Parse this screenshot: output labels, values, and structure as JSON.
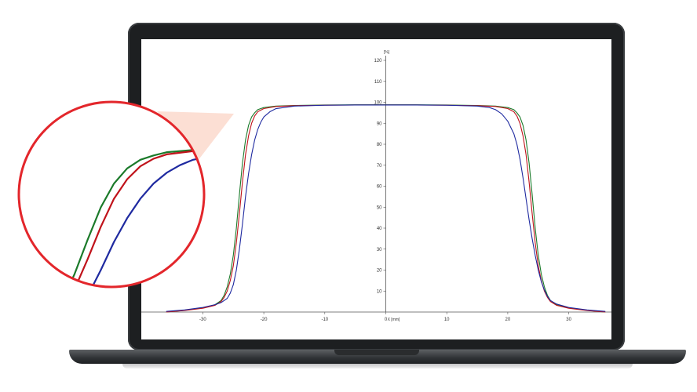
{
  "chart_data": {
    "type": "line",
    "title": "",
    "xlabel": "X [mm]",
    "ylabel": "[%]",
    "xlim": [
      -37,
      37
    ],
    "ylim": [
      0,
      120
    ],
    "x_ticks": [
      -30,
      -20,
      -10,
      0,
      10,
      20,
      30
    ],
    "y_ticks": [
      10,
      20,
      30,
      40,
      50,
      60,
      70,
      80,
      90,
      100,
      110,
      120
    ],
    "grid": false,
    "series": [
      {
        "color": "#1b7a2a",
        "x": [
          -36,
          -33,
          -30,
          -28,
          -27,
          -26.5,
          -26,
          -25.5,
          -25,
          -24.5,
          -24,
          -23.5,
          -23,
          -22.5,
          -22,
          -21.5,
          -21,
          -20,
          -18,
          -15,
          -10,
          -5,
          0,
          5,
          10,
          15,
          18,
          20,
          21,
          21.5,
          22,
          22.5,
          23,
          23.5,
          24,
          24.5,
          25,
          25.5,
          26,
          26.5,
          27,
          28,
          30,
          33,
          36
        ],
        "y": [
          0,
          0.8,
          2,
          3.5,
          5.5,
          8,
          12,
          18,
          27,
          40,
          56,
          71,
          82,
          89,
          93,
          95,
          96.5,
          97.5,
          98.2,
          98.5,
          98.7,
          98.8,
          98.8,
          98.8,
          98.7,
          98.5,
          98.2,
          97.5,
          96.5,
          95,
          93,
          89,
          82,
          71,
          56,
          40,
          27,
          18,
          12,
          8,
          5.5,
          3.5,
          2,
          0.8,
          0
        ]
      },
      {
        "color": "#c0131b",
        "x": [
          -36,
          -33,
          -30,
          -28,
          -27,
          -26.5,
          -26,
          -25.5,
          -25,
          -24.5,
          -24,
          -23.5,
          -23,
          -22.5,
          -22,
          -21.5,
          -21,
          -20,
          -18,
          -15,
          -10,
          -5,
          0,
          5,
          10,
          15,
          18,
          20,
          21,
          21.5,
          22,
          22.5,
          23,
          23.5,
          24,
          24.5,
          25,
          25.5,
          26,
          26.5,
          27,
          28,
          30,
          33,
          36
        ],
        "y": [
          0,
          0.7,
          1.8,
          3.2,
          5,
          7,
          10,
          15,
          22,
          33,
          47,
          62,
          75,
          84,
          90,
          93.5,
          95.5,
          97,
          98,
          98.4,
          98.6,
          98.7,
          98.7,
          98.7,
          98.6,
          98.4,
          98,
          97,
          95.5,
          93.5,
          90,
          84,
          75,
          62,
          47,
          33,
          22,
          15,
          10,
          7,
          5,
          3.2,
          1.8,
          0.7,
          0
        ]
      },
      {
        "color": "#1f2aa0",
        "x": [
          -36,
          -33,
          -30,
          -28,
          -27,
          -26,
          -25.5,
          -25,
          -24.5,
          -24,
          -23.5,
          -23,
          -22.5,
          -22,
          -21.5,
          -21,
          -20.5,
          -20,
          -19,
          -18,
          -15,
          -10,
          -5,
          0,
          5,
          10,
          15,
          17,
          18,
          19,
          20,
          21,
          21.5,
          22,
          22.5,
          23,
          23.5,
          24,
          24.5,
          25,
          25.5,
          26,
          26.5,
          27,
          28,
          30,
          33,
          36
        ],
        "y": [
          0.3,
          1,
          2.2,
          3.5,
          4.5,
          6.5,
          9,
          13,
          20,
          30,
          42,
          55,
          66,
          75,
          82,
          87,
          90.5,
          93,
          95.5,
          97,
          98.2,
          98.6,
          98.7,
          98.7,
          98.7,
          98.6,
          98.2,
          97.5,
          96.5,
          94.5,
          91,
          85,
          80,
          73,
          64,
          54,
          44,
          35,
          27,
          20,
          14.5,
          10.5,
          7.5,
          5.5,
          3.8,
          2.2,
          1,
          0.3
        ]
      }
    ]
  }
}
